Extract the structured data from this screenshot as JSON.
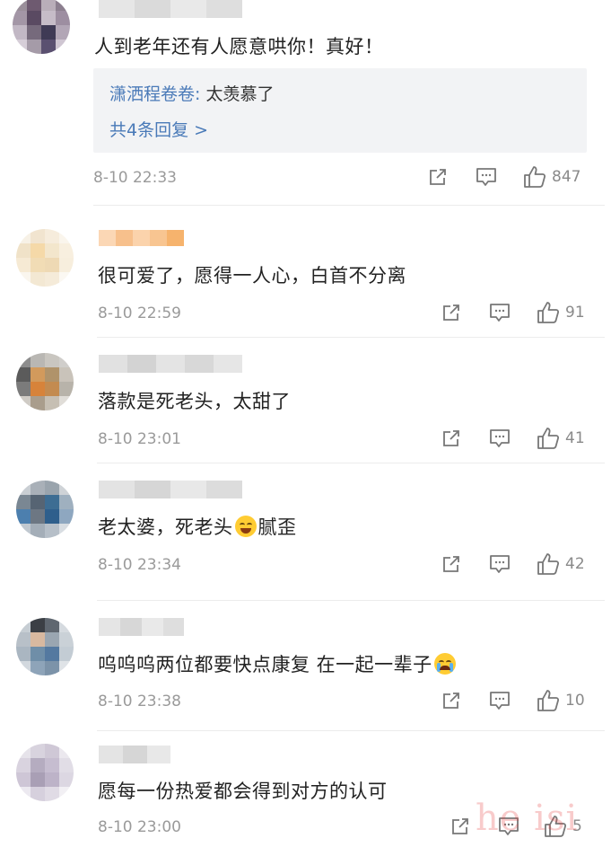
{
  "comments": [
    {
      "text": "人到老年还有人愿意哄你！真好！",
      "time": "8-10 22:33",
      "likes": "847",
      "reply": {
        "user": "潇洒程卷卷",
        "sep": ": ",
        "text": "太羡慕了",
        "more": "共4条回复 >"
      }
    },
    {
      "text": "很可爱了，愿得一人心，白首不分离",
      "time": "8-10 22:59",
      "likes": "91"
    },
    {
      "text": "落款是死老头，太甜了",
      "time": "8-10 23:01",
      "likes": "41"
    },
    {
      "text_before": "老太婆，死老头",
      "emoji": "laugh-emoji",
      "text_after": "腻歪",
      "time": "8-10 23:34",
      "likes": "42"
    },
    {
      "text_before": "呜呜呜两位都要快点康复 在一起一辈子",
      "emoji": "cry-emoji",
      "time": "8-10 23:38",
      "likes": "10"
    },
    {
      "text": "愿每一份热爱都会得到对方的认可",
      "time": "8-10 23:00",
      "likes": "5"
    }
  ],
  "icons": [
    "share-icon",
    "comment-icon",
    "like-icon"
  ],
  "colors": {
    "link": "#4a7ab8",
    "meta": "#9a9a9a",
    "reply_bg": "#f2f3f5"
  },
  "watermark": "he isi"
}
